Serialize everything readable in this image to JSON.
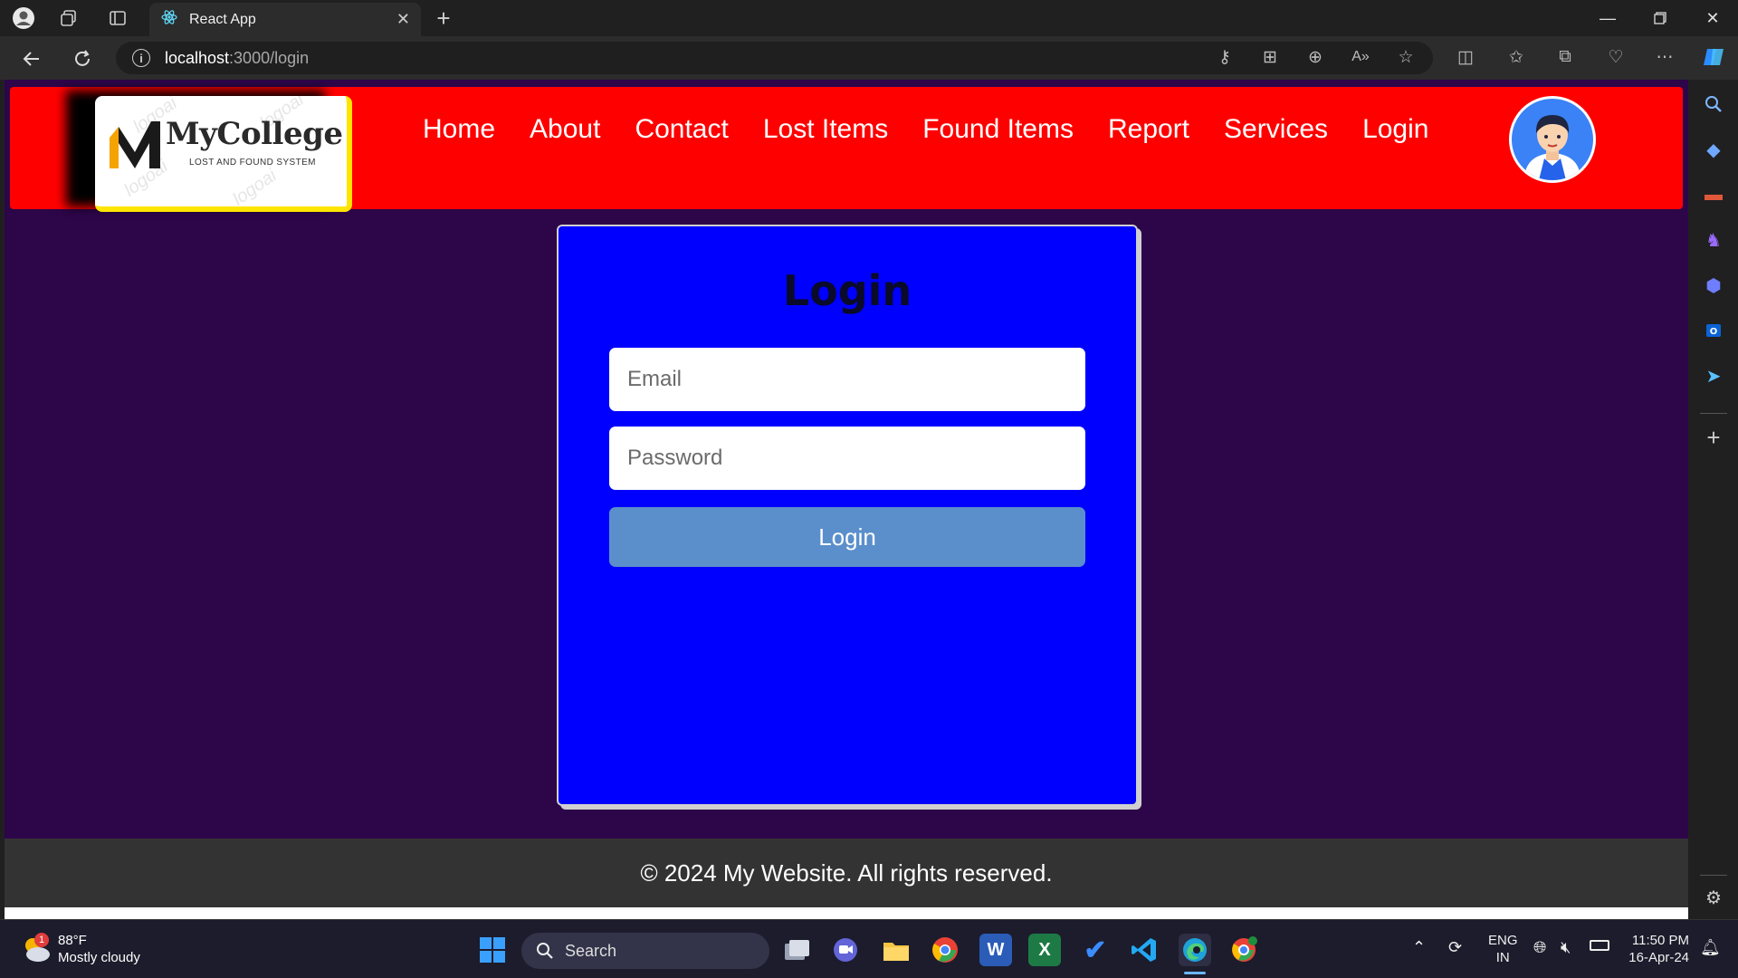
{
  "browser": {
    "tab_title": "React App",
    "url_host": "localhost",
    "url_path": ":3000/login"
  },
  "site": {
    "logo_name": "MyCollege",
    "logo_subtitle": "LOST AND FOUND SYSTEM",
    "logo_watermark": "logoai",
    "nav": [
      "Home",
      "About",
      "Contact",
      "Lost Items",
      "Found Items",
      "Report",
      "Services",
      "Login"
    ]
  },
  "login_form": {
    "title": "Login",
    "email_placeholder": "Email",
    "password_placeholder": "Password",
    "submit_label": "Login"
  },
  "footer": {
    "text": "© 2024 My Website. All rights reserved."
  },
  "taskbar": {
    "weather_temp": "88°F",
    "weather_desc": "Mostly cloudy",
    "weather_badge": "1",
    "search_label": "Search",
    "lang_line1": "ENG",
    "lang_line2": "IN",
    "time": "11:50 PM",
    "date": "16-Apr-24"
  },
  "colors": {
    "header": "#ff0000",
    "card": "#0000ff",
    "page_bg": "#2d0549",
    "button": "#5b8fcb",
    "logo_accent": "#ffe500"
  }
}
